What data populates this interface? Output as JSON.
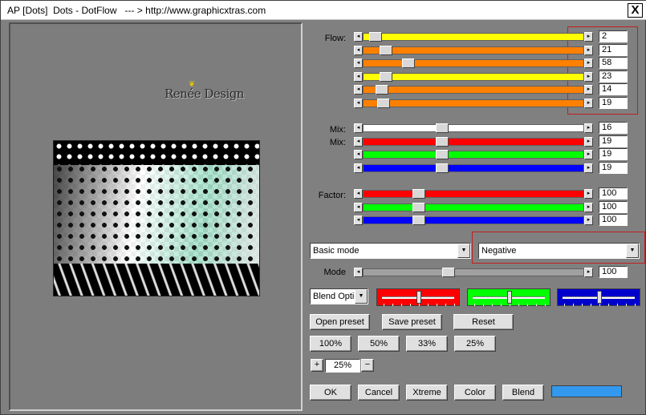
{
  "window": {
    "title": "AP [Dots]  Dots - DotFlow   --- > http://www.graphicxtras.com",
    "close_label": "X"
  },
  "preview": {
    "logo_text": "Renée Design"
  },
  "labels": {
    "flow": "Flow:",
    "mix1": "Mix:",
    "mix2": "Mix:",
    "factor": "Factor:",
    "mode": "Mode"
  },
  "arrows": {
    "left": "◂",
    "right": "▸",
    "down": "▼"
  },
  "flow_values": [
    "2",
    "21",
    "58",
    "23",
    "14",
    "19"
  ],
  "flow_levels": [
    0.03,
    0.08,
    0.19,
    0.08,
    0.06,
    0.07
  ],
  "flow_colors": [
    "#ffff00",
    "#ff8000",
    "#ff8000",
    "#ffff00",
    "#ff8000",
    "#ff8000"
  ],
  "mix_values": [
    "16",
    "19",
    "19",
    "19"
  ],
  "mix_levels": [
    0.35,
    0.35,
    0.35,
    0.35
  ],
  "mix_colors": [
    "#ffffff",
    "#ff0000",
    "#00ff00",
    "#0000ff"
  ],
  "factor_values": [
    "100",
    "100",
    "100"
  ],
  "factor_levels": [
    0.24,
    0.24,
    0.24
  ],
  "factor_colors": [
    "#ff0000",
    "#00ff00",
    "#0000ff"
  ],
  "mode_select": {
    "value": "Basic mode"
  },
  "negative_select": {
    "value": "Negative"
  },
  "mode_slider": {
    "value": "100",
    "level": 0.38
  },
  "blend_options": {
    "value": "Blend Optio"
  },
  "swatches": {
    "colors": [
      "#ff0000",
      "#00ff00",
      "#0000cc"
    ],
    "levels": [
      0.5,
      0.5,
      0.5
    ]
  },
  "buttons": {
    "open_preset": "Open preset",
    "save_preset": "Save preset",
    "reset": "Reset",
    "zoom100": "100%",
    "zoom50": "50%",
    "zoom33": "33%",
    "zoom25": "25%",
    "plus": "+",
    "minus": "−",
    "zoom_value": "25%",
    "ok": "OK",
    "cancel": "Cancel",
    "xtreme": "Xtreme",
    "color": "Color",
    "blend": "Blend"
  },
  "color_bar": {
    "color": "#3399ee"
  }
}
